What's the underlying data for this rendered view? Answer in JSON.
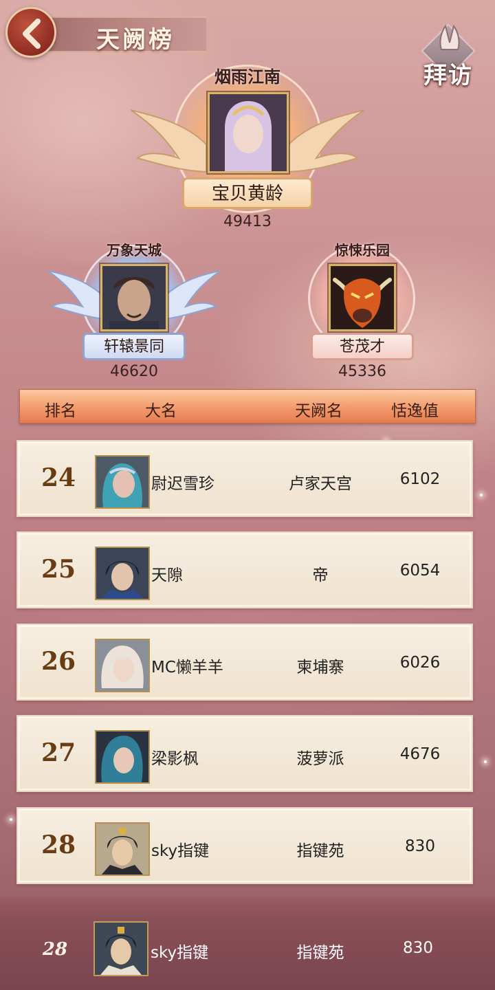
{
  "header": {
    "title": "天阙榜",
    "visit_label": "拜访"
  },
  "podium": {
    "first": {
      "guild": "烟雨江南",
      "name": "宝贝黄龄",
      "score": "49413"
    },
    "second": {
      "guild": "万象天城",
      "name": "轩辕景同",
      "score": "46620"
    },
    "third": {
      "guild": "惊悚乐园",
      "name": "苍茂才",
      "score": "45336"
    }
  },
  "table": {
    "columns": [
      "排名",
      "大名",
      "天阙名",
      "恬逸值"
    ],
    "rows": [
      {
        "rank": "24",
        "name": "尉迟雪珍",
        "guild": "卢家天宫",
        "score": "6102"
      },
      {
        "rank": "25",
        "name": "天隙",
        "guild": "帝",
        "score": "6054"
      },
      {
        "rank": "26",
        "name": "MC懒羊羊",
        "guild": "柬埔寨",
        "score": "6026"
      },
      {
        "rank": "27",
        "name": "梁影枫",
        "guild": "菠萝派",
        "score": "4676"
      },
      {
        "rank": "28",
        "name": "sky指键",
        "guild": "指键苑",
        "score": "830"
      }
    ]
  },
  "self": {
    "rank": "28",
    "name": "sky指键",
    "guild": "指键苑",
    "score": "830"
  }
}
